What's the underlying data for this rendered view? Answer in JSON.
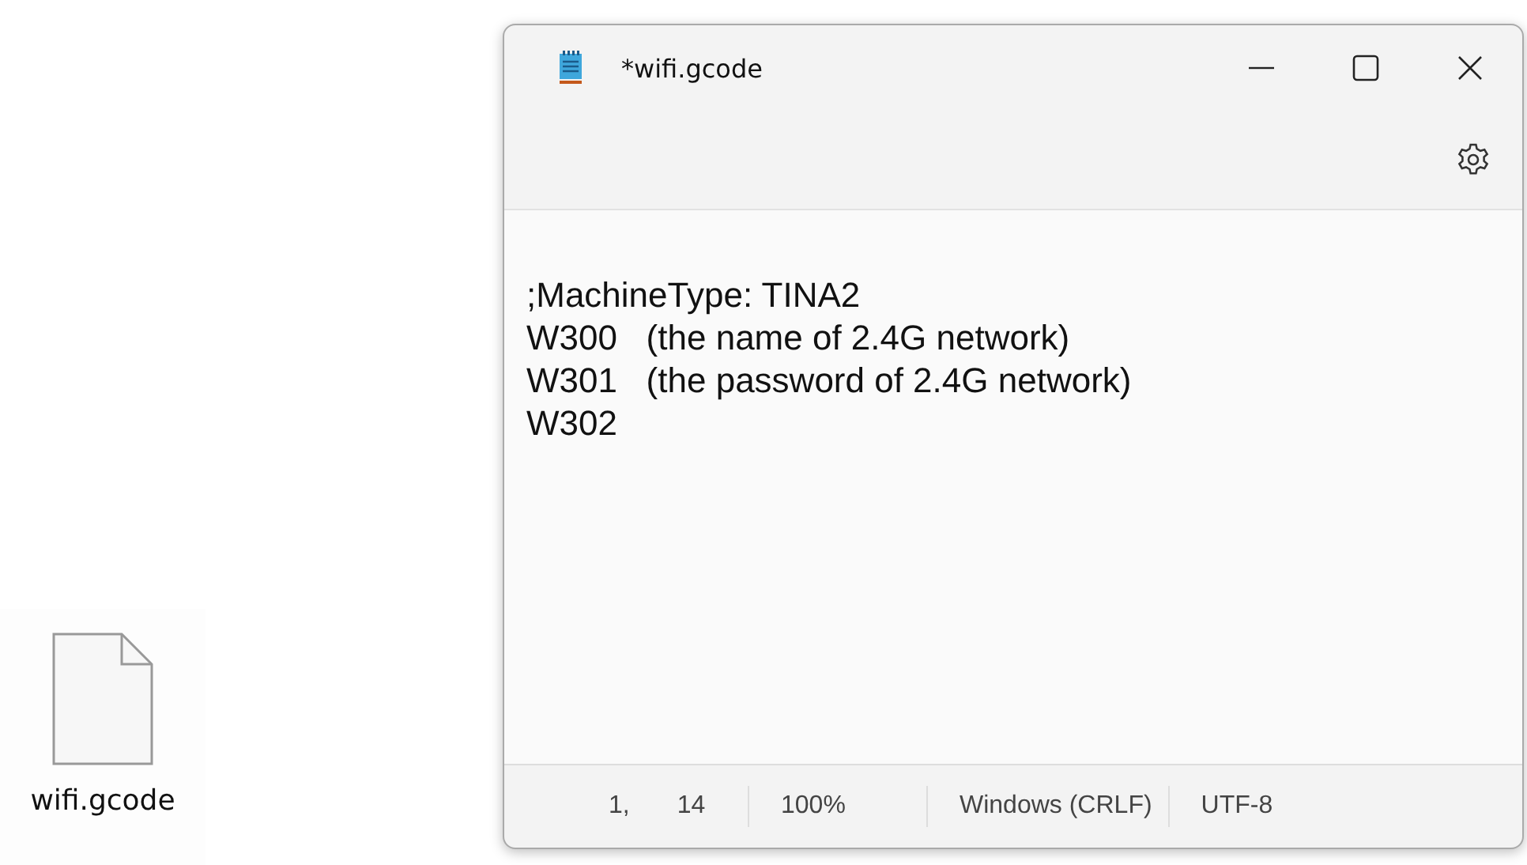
{
  "desktop_icon": {
    "label": "wifi.gcode"
  },
  "window": {
    "title": "*wifi.gcode"
  },
  "editor": {
    "lines": [
      ";MachineType: TINA2",
      "W300   (the name of 2.4G network)",
      "W301   (the password of 2.4G network)",
      "W302"
    ]
  },
  "status_bar": {
    "line": "1,",
    "column": "14",
    "zoom": "100%",
    "line_ending": "Windows (CRLF)",
    "encoding": "UTF-8"
  }
}
